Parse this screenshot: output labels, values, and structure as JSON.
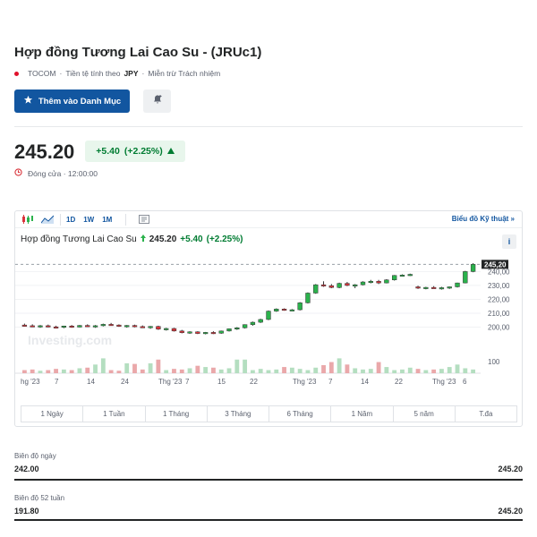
{
  "header": {
    "title": "Hợp đồng Tương Lai Cao Su - (JRUc1)",
    "exchange": "TOCOM",
    "currency_label": "Tiền tệ tính theo",
    "currency": "JPY",
    "disclaimer": "Miễn trừ Trách nhiệm",
    "watchlist_label": "Thêm vào Danh Mục"
  },
  "quote": {
    "price": "245.20",
    "change": "+5.40",
    "change_pct": "(+2.25%)",
    "close_label": "Đóng cửa · 12:00:00"
  },
  "chart_toolbar": {
    "ranges": [
      "1D",
      "1W",
      "1M"
    ],
    "tech_link": "Biểu đồ Kỹ thuật »"
  },
  "chart_legend": {
    "name": "Hợp đồng Tương Lai Cao Su",
    "last": "245.20",
    "change": "+5.40",
    "change_pct": "(+2.25%)",
    "info": "i"
  },
  "chart_data": {
    "type": "candlestick",
    "y_ticks": [
      "240,00",
      "230,00",
      "220,00",
      "210,00",
      "200,00"
    ],
    "volume_tick": "100",
    "last_marker": "245,20",
    "x_ticks": [
      "hg '23",
      "7",
      "14",
      "24",
      "Thg '23",
      "7",
      "15",
      "22",
      "Thg '23",
      "7",
      "14",
      "22",
      "Thg '23",
      "6"
    ],
    "watermark": "Investing.com",
    "ylim": [
      190,
      248
    ],
    "candles": [
      [
        201.5,
        202.5,
        200.5,
        201.0
      ],
      [
        201.0,
        202.0,
        200.0,
        200.5
      ],
      [
        200.5,
        201.5,
        199.5,
        201.0
      ],
      [
        201.0,
        201.8,
        199.8,
        200.2
      ],
      [
        200.2,
        201.0,
        199.0,
        200.0
      ],
      [
        200.0,
        201.0,
        199.2,
        200.8
      ],
      [
        200.8,
        201.5,
        199.5,
        200.0
      ],
      [
        200.0,
        201.5,
        199.8,
        201.2
      ],
      [
        201.2,
        202.0,
        200.2,
        200.5
      ],
      [
        200.5,
        201.5,
        199.5,
        201.0
      ],
      [
        201.0,
        202.5,
        200.5,
        202.0
      ],
      [
        202.0,
        203.0,
        201.0,
        201.5
      ],
      [
        201.5,
        202.0,
        200.2,
        200.6
      ],
      [
        200.6,
        201.5,
        199.6,
        201.2
      ],
      [
        201.2,
        201.8,
        199.8,
        200.4
      ],
      [
        200.4,
        201.2,
        199.4,
        199.8
      ],
      [
        199.8,
        200.8,
        198.8,
        200.5
      ],
      [
        200.5,
        201.0,
        198.0,
        198.5
      ],
      [
        198.5,
        199.5,
        197.5,
        199.0
      ],
      [
        199.0,
        199.5,
        196.8,
        197.2
      ],
      [
        197.2,
        198.0,
        195.5,
        196.0
      ],
      [
        196.0,
        197.0,
        195.2,
        196.6
      ],
      [
        196.6,
        197.0,
        195.0,
        195.4
      ],
      [
        195.4,
        196.5,
        194.8,
        196.2
      ],
      [
        196.2,
        197.0,
        195.0,
        195.6
      ],
      [
        195.6,
        197.5,
        195.2,
        197.2
      ],
      [
        197.2,
        199.0,
        196.8,
        198.8
      ],
      [
        198.8,
        200.0,
        198.0,
        199.5
      ],
      [
        199.5,
        202.0,
        199.0,
        201.8
      ],
      [
        201.8,
        204.0,
        201.0,
        203.5
      ],
      [
        203.5,
        206.0,
        203.0,
        205.5
      ],
      [
        205.5,
        212.0,
        205.0,
        211.5
      ],
      [
        211.5,
        213.5,
        211.0,
        213.0
      ],
      [
        213.0,
        213.5,
        211.8,
        212.2
      ],
      [
        212.2,
        213.0,
        211.5,
        212.5
      ],
      [
        212.5,
        218.0,
        212.0,
        217.5
      ],
      [
        217.5,
        225.0,
        217.0,
        224.5
      ],
      [
        224.5,
        231.0,
        224.0,
        230.5
      ],
      [
        230.5,
        233.0,
        229.0,
        229.8
      ],
      [
        229.8,
        231.0,
        228.0,
        228.5
      ],
      [
        228.5,
        232.0,
        228.0,
        231.5
      ],
      [
        231.5,
        232.5,
        229.5,
        230.0
      ],
      [
        230.0,
        231.0,
        228.0,
        230.5
      ],
      [
        230.5,
        233.0,
        230.0,
        232.5
      ],
      [
        232.5,
        234.0,
        231.5,
        233.0
      ],
      [
        233.0,
        234.0,
        231.0,
        231.8
      ],
      [
        231.8,
        234.5,
        231.5,
        234.0
      ],
      [
        234.0,
        237.5,
        233.5,
        237.2
      ],
      [
        237.2,
        238.0,
        236.5,
        237.5
      ],
      [
        237.5,
        238.5,
        236.8,
        238.0
      ],
      [
        229.0,
        229.8,
        227.5,
        228.2
      ],
      [
        228.2,
        229.0,
        227.2,
        228.6
      ],
      [
        228.6,
        229.5,
        227.8,
        228.0
      ],
      [
        228.0,
        229.0,
        227.0,
        228.4
      ],
      [
        228.4,
        229.2,
        227.5,
        229.0
      ],
      [
        229.0,
        232.0,
        228.5,
        231.8
      ],
      [
        231.8,
        240.5,
        231.5,
        240.0
      ],
      [
        240.0,
        246.0,
        239.5,
        245.2
      ]
    ],
    "volumes": [
      5,
      6,
      4,
      5,
      7,
      6,
      5,
      8,
      9,
      14,
      24,
      5,
      4,
      16,
      15,
      6,
      16,
      22,
      5,
      7,
      6,
      8,
      12,
      10,
      9,
      6,
      8,
      22,
      22,
      5,
      7,
      5,
      6,
      10,
      9,
      7,
      5,
      9,
      13,
      18,
      24,
      14,
      8,
      6,
      7,
      18,
      10,
      5,
      6,
      9,
      7,
      5,
      6,
      7,
      10,
      14,
      8,
      6
    ]
  },
  "periods": [
    "1 Ngày",
    "1 Tuần",
    "1 Tháng",
    "3 Tháng",
    "6 Tháng",
    "1 Năm",
    "5 năm",
    "T.đa"
  ],
  "ranges": {
    "day_label": "Biên độ ngày",
    "day_low": "242.00",
    "day_high": "245.20",
    "day_fill_pct": 100,
    "week52_label": "Biên độ 52 tuần",
    "week52_low": "191.80",
    "week52_high": "245.20",
    "week52_fill_pct": 100
  },
  "colors": {
    "up": "#2bb24c",
    "down": "#d9343b",
    "vol_up": "#b4dec0",
    "vol_down": "#eaa8aa",
    "accent": "#1256a0"
  }
}
